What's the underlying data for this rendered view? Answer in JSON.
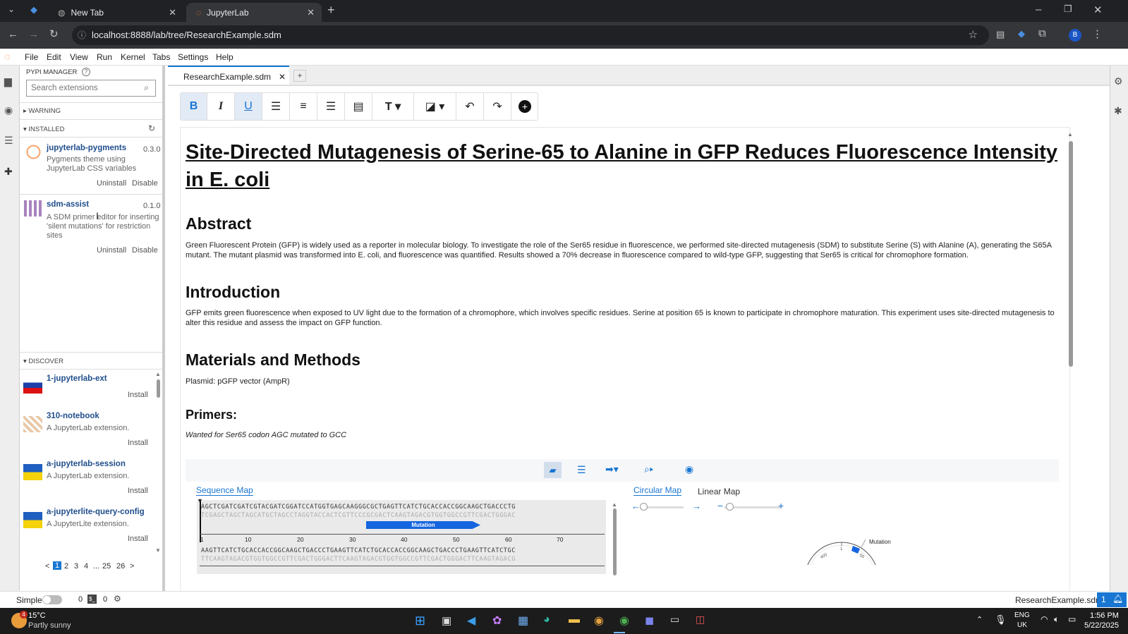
{
  "browser": {
    "tabs": [
      {
        "label": "New Tab"
      },
      {
        "label": "JupyterLab"
      }
    ],
    "new_tab_symbol": "+",
    "url": "localhost:8888/lab/tree/ResearchExample.sdm"
  },
  "menu": [
    "File",
    "Edit",
    "View",
    "Run",
    "Kernel",
    "Tabs",
    "Settings",
    "Help"
  ],
  "pypi": {
    "title": "PYPI MANAGER",
    "search_placeholder": "Search extensions",
    "warning_label": "WARNING",
    "installed_label": "INSTALLED",
    "installed": [
      {
        "name": "jupyterlab-pygments",
        "version": "0.3.0",
        "desc": "Pygments theme using JupyterLab CSS variables",
        "uninstall": "Uninstall",
        "disable": "Disable"
      },
      {
        "name": "sdm-assist",
        "version": "0.1.0",
        "desc": "A SDM primer editor for inserting 'silent mutations' for restriction sites",
        "uninstall": "Uninstall",
        "disable": "Disable"
      }
    ],
    "discover_label": "DISCOVER",
    "discover": [
      {
        "name": "1-jupyterlab-ext",
        "desc": "",
        "install": "Install"
      },
      {
        "name": "310-notebook",
        "desc": "A JupyterLab extension.",
        "install": "Install"
      },
      {
        "name": "a-jupyterlab-session",
        "desc": "A JupyterLab extension.",
        "install": "Install"
      },
      {
        "name": "a-jupyterlite-query-config",
        "desc": "A JupyterLite extension.",
        "install": "Install"
      }
    ],
    "pagination": [
      "<",
      "1",
      "2",
      "3",
      "4",
      "...",
      "25",
      "26",
      ">"
    ]
  },
  "editor": {
    "tab_label": "ResearchExample.sdm",
    "title": "Site-Directed Mutagenesis of Serine-65 to Alanine in GFP Reduces Fluorescence Intensity in E. coli",
    "abstract_heading": "Abstract",
    "abstract_text": "Green Fluorescent Protein (GFP) is widely used as a reporter in molecular biology. To investigate the role of the Ser65 residue in fluorescence, we performed site-directed mutagenesis (SDM) to substitute Serine (S) with Alanine (A), generating the S65A mutant. The mutant plasmid was transformed into E. coli, and fluorescence was quantified. Results showed a 70% decrease in fluorescence compared to wild-type GFP, suggesting that Ser65 is critical for chromophore formation.",
    "intro_heading": "Introduction",
    "intro_text": "GFP emits green fluorescence when exposed to UV light due to the formation of a chromophore, which involves specific residues. Serine at position 65 is known to participate in chromophore maturation. This experiment uses site-directed mutagenesis to alter this residue and assess the impact on GFP function.",
    "methods_heading": "Materials and Methods",
    "plasmid_text": "Plasmid: pGFP vector (AmpR)",
    "primers_heading": "Primers:",
    "primers_text": "Wanted for Ser65 codon AGC mutated to GCC"
  },
  "seqviewer": {
    "sequence_map_tab": "Sequence Map",
    "circular_map_tab": "Circular Map",
    "linear_map_tab": "Linear Map",
    "seq1_top": "AGCTCGATCGATCGTACGATCGGATCCATGGTGAGCAAGGGCGCTGAGTTCATCTGCACCACCGGCAAGCTGACCCTG",
    "seq1_bottom": "TCGAGCTAGCTAGCATGCTAGCCTAGGTACCACTCGTTCCCGCGACTCAAGTAGACGTGGTGGCCGTTCGACTGGGAC",
    "feature_label": "Mutation",
    "ticks": [
      "1",
      "10",
      "20",
      "30",
      "40",
      "50",
      "60",
      "70"
    ],
    "seq2_top": "AAGTTCATCTGCACCACCGGCAAGCTGACCCTGAAGTTCATCTGCACCACCGGCAAGCTGACCCTGAAGTTCATCTGC",
    "seq2_bottom": "TTCAAGTAGACGTGGTGGCCGTTCGACTGGGACTTCAAGTAGACGTGGTGGCCGTTCGACTGGGACTTCAAGTAGACG",
    "circ_label": "Mutation",
    "circ_ticks": [
      "400",
      "1",
      "50"
    ]
  },
  "status": {
    "simple_label": "Simple",
    "terminals": "0",
    "kernels": "0",
    "file": "ResearchExample.sdm",
    "notif_count": "1"
  },
  "taskbar": {
    "weather_temp": "15°C",
    "weather_desc": "Partly sunny",
    "weather_badge": "4",
    "lang": "ENG",
    "region": "UK",
    "time": "1:56 PM",
    "date": "5/22/2025"
  },
  "colors": {
    "accent": "#1976d2",
    "feature": "#1565e0",
    "link": "#1f4e8c"
  }
}
